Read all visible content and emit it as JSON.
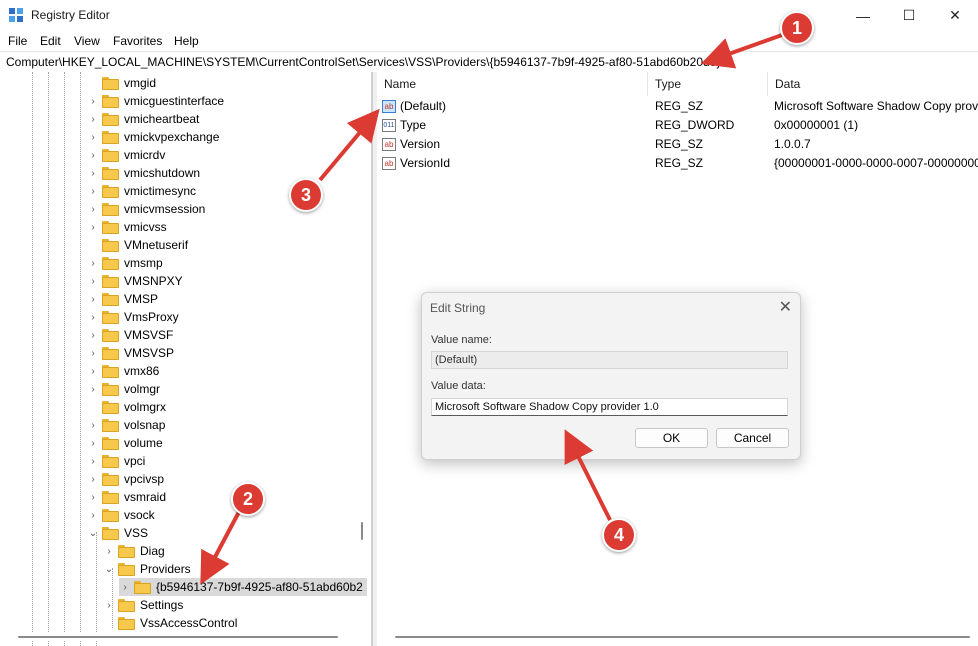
{
  "window": {
    "title": "Registry Editor",
    "controls": {
      "minimize": "—",
      "maximize": "☐",
      "close": "✕"
    }
  },
  "menu": [
    "File",
    "Edit",
    "View",
    "Favorites",
    "Help"
  ],
  "address": "Computer\\HKEY_LOCAL_MACHINE\\SYSTEM\\CurrentControlSet\\Services\\VSS\\Providers\\{b5946137-7b9f-4925-af80-51abd60b20d5}",
  "tree": {
    "items": [
      {
        "label": "vmgid",
        "chevron": ""
      },
      {
        "label": "vmicguestinterface",
        "chevron": "›"
      },
      {
        "label": "vmicheartbeat",
        "chevron": "›"
      },
      {
        "label": "vmickvpexchange",
        "chevron": "›"
      },
      {
        "label": "vmicrdv",
        "chevron": "›"
      },
      {
        "label": "vmicshutdown",
        "chevron": "›"
      },
      {
        "label": "vmictimesync",
        "chevron": "›"
      },
      {
        "label": "vmicvmsession",
        "chevron": "›"
      },
      {
        "label": "vmicvss",
        "chevron": "›"
      },
      {
        "label": "VMnetuserif",
        "chevron": ""
      },
      {
        "label": "vmsmp",
        "chevron": "›"
      },
      {
        "label": "VMSNPXY",
        "chevron": "›"
      },
      {
        "label": "VMSP",
        "chevron": "›"
      },
      {
        "label": "VmsProxy",
        "chevron": "›"
      },
      {
        "label": "VMSVSF",
        "chevron": "›"
      },
      {
        "label": "VMSVSP",
        "chevron": "›"
      },
      {
        "label": "vmx86",
        "chevron": "›"
      },
      {
        "label": "volmgr",
        "chevron": "›"
      },
      {
        "label": "volmgrx",
        "chevron": ""
      },
      {
        "label": "volsnap",
        "chevron": "›"
      },
      {
        "label": "volume",
        "chevron": "›"
      },
      {
        "label": "vpci",
        "chevron": "›"
      },
      {
        "label": "vpcivsp",
        "chevron": "›"
      },
      {
        "label": "vsmraid",
        "chevron": "›"
      },
      {
        "label": "vsock",
        "chevron": "›"
      },
      {
        "label": "VSS",
        "chevron": "⌄"
      },
      {
        "label": "Diag",
        "chevron": "›"
      },
      {
        "label": "Providers",
        "chevron": "⌄"
      },
      {
        "label": "{b5946137-7b9f-4925-af80-51abd60b2",
        "chevron": "›"
      },
      {
        "label": "Settings",
        "chevron": "›"
      },
      {
        "label": "VssAccessControl",
        "chevron": ""
      }
    ]
  },
  "list": {
    "headers": {
      "name": "Name",
      "type": "Type",
      "data": "Data"
    },
    "rows": [
      {
        "name": "(Default)",
        "type": "REG_SZ",
        "data": "Microsoft Software Shadow Copy prov",
        "icon": "ab"
      },
      {
        "name": "Type",
        "type": "REG_DWORD",
        "data": "0x00000001 (1)",
        "icon": "011"
      },
      {
        "name": "Version",
        "type": "REG_SZ",
        "data": "1.0.0.7",
        "icon": "ab"
      },
      {
        "name": "VersionId",
        "type": "REG_SZ",
        "data": "{00000001-0000-0000-0007-0000000000",
        "icon": "ab"
      }
    ]
  },
  "dialog": {
    "title": "Edit String",
    "close": "✕",
    "value_name_label": "Value name:",
    "value_name": "(Default)",
    "value_data_label": "Value data:",
    "value_data": "Microsoft Software Shadow Copy provider 1.0",
    "ok": "OK",
    "cancel": "Cancel"
  },
  "callouts": [
    "1",
    "2",
    "3",
    "4"
  ],
  "colors": {
    "callout": "#dc3b33",
    "folder": "#f6c94d"
  }
}
